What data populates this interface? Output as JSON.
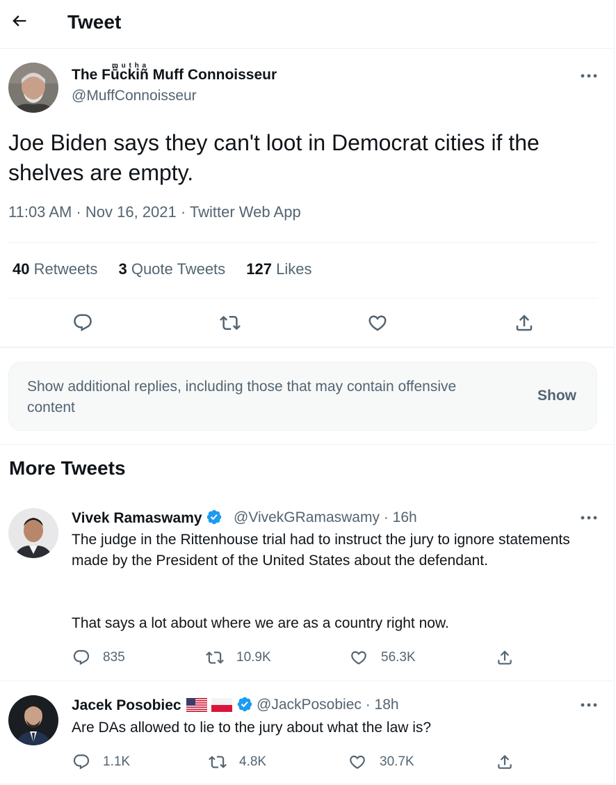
{
  "header": {
    "title": "Tweet"
  },
  "main_tweet": {
    "name": "The Fṻckiñ Muff Connoisseur",
    "name_super": "m u t h a",
    "handle": "@MuffConnoisseur",
    "text": "Joe Biden says they can't loot in Democrat cities if the shelves are empty.",
    "meta": "11:03 AM · Nov 16, 2021 · Twitter Web App",
    "stats": {
      "retweets_count": "40",
      "retweets_label": "Retweets",
      "quotes_count": "3",
      "quotes_label": "Quote Tweets",
      "likes_count": "127",
      "likes_label": "Likes"
    }
  },
  "notice": {
    "text": "Show additional replies, including those that may contain offensive content",
    "button": "Show"
  },
  "more_tweets": {
    "title": "More Tweets",
    "tweets": [
      {
        "name": "Vivek Ramaswamy",
        "handle": "@VivekGRamaswamy · 16h",
        "text_p1": "The judge in the Rittenhouse trial had to instruct the jury to ignore statements made by the President of the United States about the defendant.",
        "text_p2": "That says a lot about where we are as a country right now.",
        "replies": "835",
        "retweets": "10.9K",
        "likes": "56.3K"
      },
      {
        "name": "Jacek Posobiec",
        "handle": "@JackPosobiec · 18h",
        "text": "Are DAs allowed to lie to the jury about what the law is?",
        "replies": "1.1K",
        "retweets": "4.8K",
        "likes": "30.7K"
      }
    ]
  },
  "colors": {
    "accent": "#1d9bf0",
    "muted": "#536471",
    "text": "#0f1419",
    "border": "#eff3f4"
  }
}
